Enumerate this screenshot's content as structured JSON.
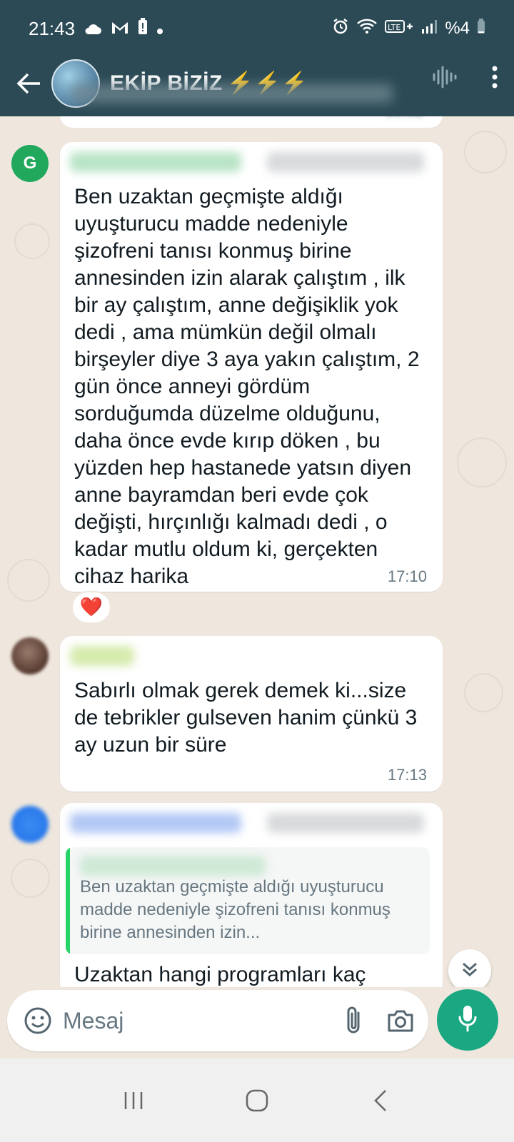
{
  "status_bar": {
    "time": "21:43",
    "battery": "%4"
  },
  "header": {
    "title": "EKİP BİZİZ",
    "title_emoji": "⚡⚡⚡"
  },
  "messages": [
    {
      "avatar_letter": "G",
      "text": "Ben uzaktan geçmişte aldığı uyuşturucu madde nedeniyle şizofreni tanısı konmuş birine annesinden izin alarak çalıştım , ilk bir ay çalıştım, anne değişiklik yok dedi , ama mümkün değil olmalı birşeyler diye 3 aya yakın çalıştım, 2 gün önce anneyi gördüm sorduğumda düzelme olduğunu, daha önce evde kırıp döken , bu yüzden hep hastanede yatsın diyen anne bayramdan beri evde çok değişti, hırçınlığı kalmadı dedi , o kadar mutlu oldum ki, gerçekten cihaz harika",
      "time": "17:10",
      "reaction": "❤️"
    },
    {
      "text": "Sabırlı olmak gerek demek ki...size de tebrikler gulseven hanim çünkü 3 ay uzun bir süre",
      "time": "17:13"
    },
    {
      "quoted_text": "Ben uzaktan geçmişte aldığı uyuşturucu madde nedeniyle şizofreni tanısı konmuş birine annesinden izin...",
      "text": "Uzaktan hangi programları kaç"
    }
  ],
  "composer": {
    "placeholder": "Mesaj"
  },
  "colors": {
    "header_bg": "#2b4a55",
    "chat_bg": "#efe7dd",
    "accent_green": "#1aa882",
    "quote_bar": "#25d366"
  }
}
